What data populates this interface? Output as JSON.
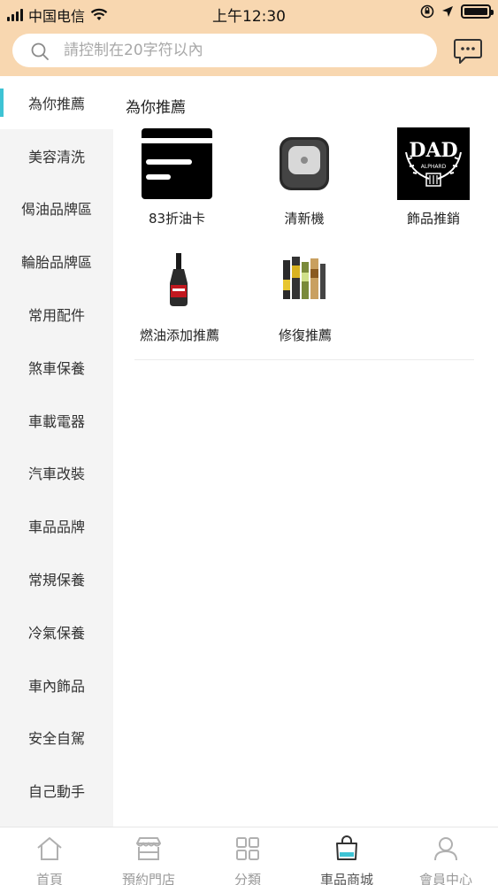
{
  "status_bar": {
    "carrier": "中国电信",
    "time": "上午12:30"
  },
  "search": {
    "placeholder": "請控制在20字符以內"
  },
  "sidebar": {
    "items": [
      {
        "label": "為你推薦",
        "active": true
      },
      {
        "label": "美容清洗"
      },
      {
        "label": "偈油品牌區"
      },
      {
        "label": "輪胎品牌區"
      },
      {
        "label": "常用配件"
      },
      {
        "label": "煞車保養"
      },
      {
        "label": "車載電器"
      },
      {
        "label": "汽車改裝"
      },
      {
        "label": "車品品牌"
      },
      {
        "label": "常規保養"
      },
      {
        "label": "冷氣保養"
      },
      {
        "label": "車內飾品"
      },
      {
        "label": "安全自駕"
      },
      {
        "label": "自己動手"
      }
    ]
  },
  "main": {
    "section_title": "為你推薦",
    "products": [
      {
        "label": "83折油卡",
        "icon": "fuel-card-icon"
      },
      {
        "label": "清新機",
        "icon": "air-freshener-icon"
      },
      {
        "label": "飾品推銷",
        "icon": "dad-logo"
      },
      {
        "label": "燃油添加推薦",
        "icon": "fuel-additive-bottle"
      },
      {
        "label": "修復推薦",
        "icon": "repair-kit"
      }
    ]
  },
  "tabbar": {
    "tabs": [
      {
        "label": "首頁",
        "icon": "home-icon"
      },
      {
        "label": "預約門店",
        "icon": "store-icon"
      },
      {
        "label": "分類",
        "icon": "grid-icon"
      },
      {
        "label": "車品商城",
        "icon": "shopping-bag-icon",
        "active": true
      },
      {
        "label": "會員中心",
        "icon": "user-icon"
      }
    ]
  },
  "colors": {
    "header_bg": "#f8d7b0",
    "accent": "#3ec3d4",
    "sidebar_bg": "#f4f4f4"
  }
}
